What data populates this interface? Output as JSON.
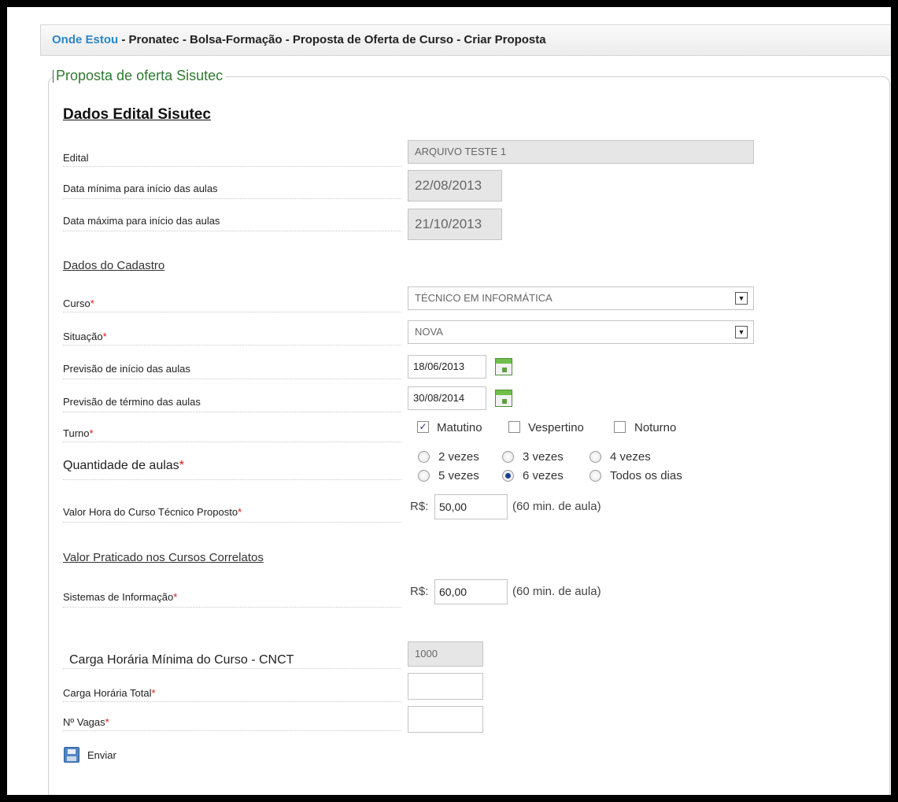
{
  "breadcrumb": {
    "home": "Onde Estou",
    "path": " - Pronatec - Bolsa-Formação - Proposta de Oferta de Curso - Criar Proposta"
  },
  "panel": {
    "legend": "Proposta de oferta Sisutec"
  },
  "edital_section": {
    "title": "Dados Edital Sisutec",
    "edital_label": "Edital",
    "edital_value": "ARQUIVO TESTE 1",
    "data_min_label": "Data mínima para início das aulas",
    "data_min_value": "22/08/2013",
    "data_max_label": "Data máxima para início das aulas",
    "data_max_value": "21/10/2013"
  },
  "cadastro": {
    "title": "Dados do Cadastro",
    "curso_label": "Curso",
    "curso_value": "TÉCNICO EM INFORMÁTICA",
    "situacao_label": "Situação",
    "situacao_value": "NOVA",
    "inicio_label": "Previsão de início das aulas",
    "inicio_value": "18/06/2013",
    "termino_label": "Previsão de término das aulas",
    "termino_value": "30/08/2014",
    "turno_label": "Turno",
    "turno_options": [
      {
        "label": "Matutino",
        "checked": true
      },
      {
        "label": "Vespertino",
        "checked": false
      },
      {
        "label": "Noturno",
        "checked": false
      }
    ],
    "qtd_label": "Quantidade de aulas",
    "qtd_options": [
      {
        "label": "2 vezes",
        "selected": false
      },
      {
        "label": "3 vezes",
        "selected": false
      },
      {
        "label": "4 vezes",
        "selected": false
      },
      {
        "label": "5 vezes",
        "selected": false
      },
      {
        "label": "6 vezes",
        "selected": true
      },
      {
        "label": "Todos os dias",
        "selected": false
      }
    ],
    "valor_hora_label": "Valor Hora do Curso Técnico Proposto",
    "currency": "R$:",
    "valor_hora_value": "50,00",
    "per_class_note": "(60 min. de aula)"
  },
  "correlatos": {
    "title": "Valor Praticado nos Cursos Correlatos",
    "sistemas_label": "Sistemas de Informação",
    "currency": "R$:",
    "sistemas_value": "60,00",
    "per_class_note": "(60 min. de aula)"
  },
  "carga": {
    "minima_label": "Carga Horária Mínima do Curso - CNCT",
    "minima_value": "1000",
    "total_label": "Carga Horária Total",
    "total_value": "",
    "vagas_label": "Nº Vagas",
    "vagas_value": ""
  },
  "actions": {
    "enviar_label": "Enviar"
  },
  "required_mark": "*",
  "colors": {
    "breadcrumb_link": "#2a86c7",
    "legend": "#2f7a2f",
    "required": "#d11111"
  }
}
